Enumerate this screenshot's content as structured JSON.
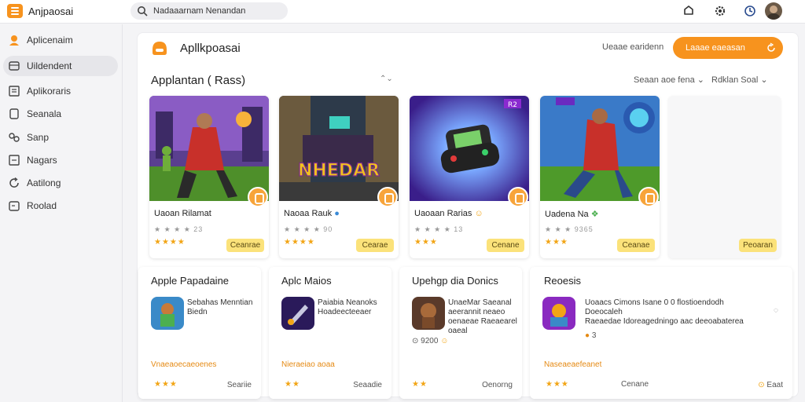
{
  "app": {
    "title": "Anjpaosai"
  },
  "search": {
    "text": "Nadaaarnam Nenandan"
  },
  "topbar_icons": [
    "notification-icon",
    "settings-icon",
    "clock-icon"
  ],
  "sidebar": {
    "items": [
      {
        "label": "Aplicenaim",
        "icon": "user-icon"
      },
      {
        "label": "Uildendent",
        "icon": "box-icon",
        "active": true
      },
      {
        "label": "Aplikoraris",
        "icon": "grid-icon"
      },
      {
        "label": "Seanala",
        "icon": "document-icon"
      },
      {
        "label": "Sanp",
        "icon": "link-icon"
      },
      {
        "label": "Nagars",
        "icon": "list-icon"
      },
      {
        "label": "Aatilong",
        "icon": "refresh-icon"
      },
      {
        "label": "Roolad",
        "icon": "file-icon"
      }
    ]
  },
  "panel": {
    "title": "Apllkpoasai",
    "subtitle": "Ueaae earidenn",
    "button": "Laaae eaeasan"
  },
  "section": {
    "title": "Applantan ( Rass)",
    "sort": "Seaan aoe fena",
    "filter": "Rdklan Soal"
  },
  "games": [
    {
      "name": "Uaoan Rilamat",
      "meta": "★ ★ ★ ★  23",
      "stars": "★★★★",
      "button": "Ceanrae"
    },
    {
      "name": "Naoaa Rauk",
      "meta": "★ ★ ★ ★  90",
      "stars": "★★★★",
      "button": "Cearae",
      "art_text": "NHEDAR"
    },
    {
      "name": "Uaoaan Rarias",
      "meta": "★ ★ ★ ★  13",
      "stars": "★★★",
      "button": "Cenane",
      "art_text": "R2"
    },
    {
      "name": "Uadena Na",
      "meta": "★ ★ ★  9365",
      "stars": "★★★",
      "button": "Ceanae"
    },
    {
      "name": "",
      "meta": "",
      "stars": "",
      "button": "Peoaran"
    }
  ],
  "bottom": [
    {
      "title": "Apple Papadaine",
      "desc": "Sebahas Menntian\nBiedn",
      "label": "Vnaeaoecaeoenes",
      "stars": "★★★",
      "right": "Seariie"
    },
    {
      "title": "Aplc Maios",
      "desc": "Paiabia Neanoks\nHoadeecteeaer",
      "label": "Nieraeiao aoaa",
      "stars": "★★",
      "right": "Seaadie"
    },
    {
      "title": "Upehgp dia Donics",
      "desc": "UnaeMar Saeanal\naeerannit neaeo\noenaeae Raeaearel\noaeal",
      "label": "",
      "stars": "★★",
      "right": "Oenorng",
      "rating": "9200"
    },
    {
      "title": "Reoesis",
      "desc": "Uoaacs Cimons Isane 0 0 flostioendodh\nDoeocaleh\nRaeaedae Idoreagedningo aac deeoabaterea",
      "label": "Naseaeaefeanet",
      "stars": "★★★",
      "right": "Cenane",
      "rating": "3",
      "extra": "Eaat"
    }
  ],
  "colors": {
    "accent": "#f7931e",
    "star": "#f2a516",
    "button_yellow": "#fbe27a"
  }
}
